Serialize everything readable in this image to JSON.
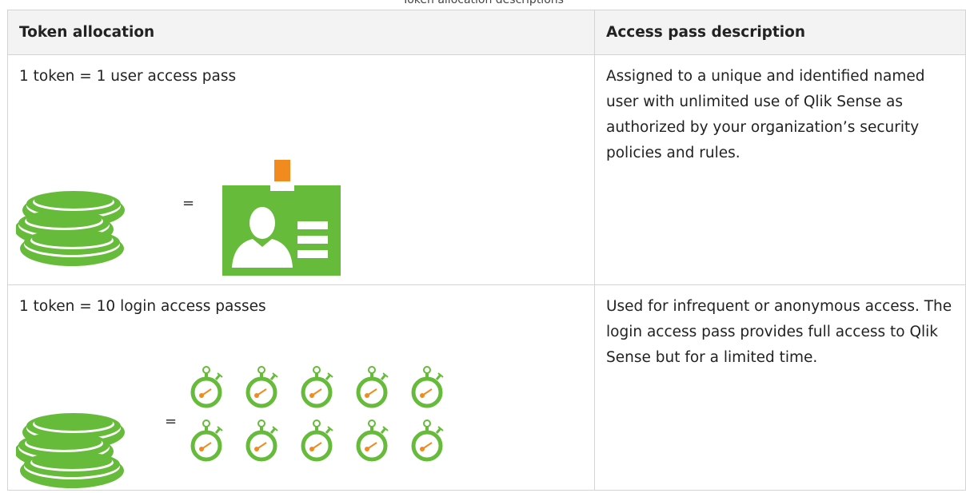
{
  "caption": "Token allocation descriptions",
  "table": {
    "headers": [
      "Token allocation",
      "Access pass description"
    ],
    "rows": [
      {
        "allocation": "1 token = 1 user access pass",
        "equals": "=",
        "description": "Assigned to a unique and identified named user with unlimited use of Qlik Sense as authorized by your organization’s security policies and rules.",
        "icons": [
          "coin-stack-icon",
          "user-id-badge-icon"
        ]
      },
      {
        "allocation": "1 token = 10 login access passes",
        "equals": "=",
        "description": "Used for infrequent or anonymous access. The login access pass provides full access to Qlik Sense but for a limited time.",
        "icons": [
          "coin-stack-icon",
          "stopwatch-icon"
        ],
        "stopwatch_count": 10
      }
    ]
  },
  "colors": {
    "brand_green": "#66bb3a",
    "accent_orange": "#f28b1f",
    "border": "#d4d4d4",
    "header_bg": "#f3f3f3"
  }
}
